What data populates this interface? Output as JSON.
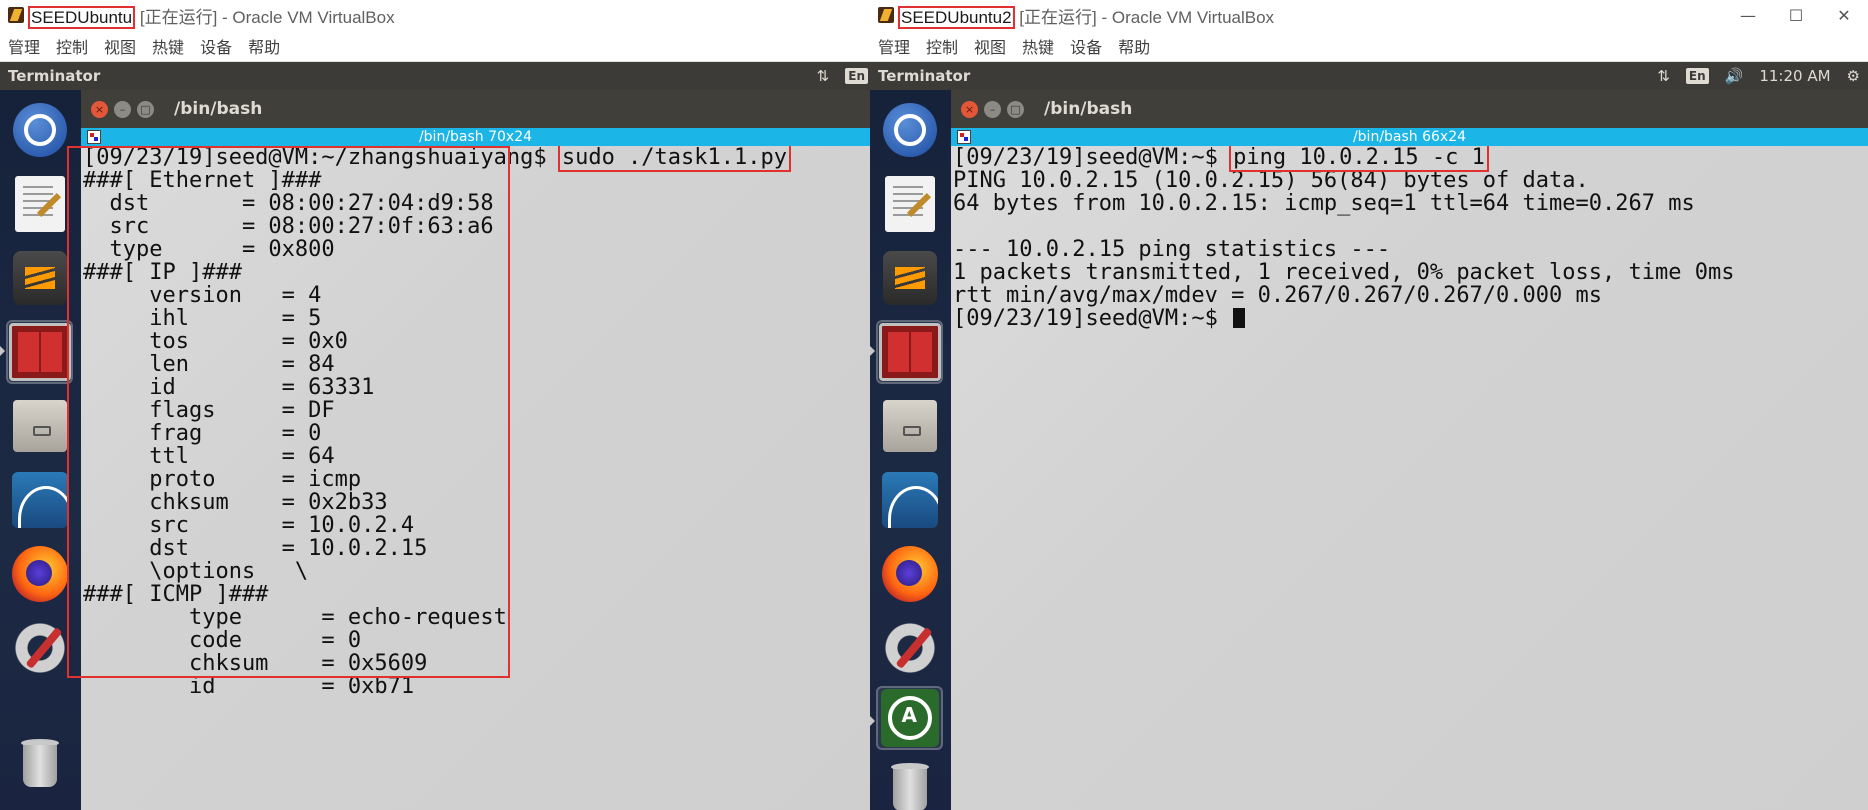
{
  "left_vm": {
    "title": {
      "vm_name": "SEEDUbuntu",
      "suffix": " [正在运行] - Oracle VM VirtualBox"
    },
    "menu": [
      "管理",
      "控制",
      "视图",
      "热键",
      "设备",
      "帮助"
    ],
    "topbar": {
      "app_name": "Terminator",
      "lang": "En"
    },
    "terminal": {
      "window_title": "/bin/bash",
      "tab_title": "/bin/bash 70x24",
      "prompt": "[09/23/19]seed@VM:~/zhangshuaiyang$ ",
      "command": "sudo ./task1.1.py",
      "output": [
        "###[ Ethernet ]###",
        "  dst       = 08:00:27:04:d9:58",
        "  src       = 08:00:27:0f:63:a6",
        "  type      = 0x800",
        "###[ IP ]###",
        "     version   = 4",
        "     ihl       = 5",
        "     tos       = 0x0",
        "     len       = 84",
        "     id        = 63331",
        "     flags     = DF",
        "     frag      = 0",
        "     ttl       = 64",
        "     proto     = icmp",
        "     chksum    = 0x2b33",
        "     src       = 10.0.2.4",
        "     dst       = 10.0.2.15",
        "     \\options   \\",
        "###[ ICMP ]###",
        "        type      = echo-request",
        "        code      = 0",
        "        chksum    = 0x5609",
        "        id        = 0xb71"
      ]
    }
  },
  "right_vm": {
    "title": {
      "vm_name": "SEEDUbuntu2",
      "suffix": " [正在运行] - Oracle VM VirtualBox"
    },
    "menu": [
      "管理",
      "控制",
      "视图",
      "热键",
      "设备",
      "帮助"
    ],
    "window_controls": {
      "minimize": "—",
      "maximize": "☐",
      "close": "✕"
    },
    "topbar": {
      "app_name": "Terminator",
      "lang": "En",
      "time": "11:20 AM",
      "network": "⇅",
      "volume": "🔊",
      "gear": "⚙"
    },
    "terminal": {
      "window_title": "/bin/bash",
      "tab_title": "/bin/bash 66x24",
      "prompt": "[09/23/19]seed@VM:~$ ",
      "command": "ping 10.0.2.15 -c 1",
      "output": [
        "PING 10.0.2.15 (10.0.2.15) 56(84) bytes of data.",
        "64 bytes from 10.0.2.15: icmp_seq=1 ttl=64 time=0.267 ms",
        "",
        "--- 10.0.2.15 ping statistics ---",
        "1 packets transmitted, 1 received, 0% packet loss, time 0ms",
        "rtt min/avg/max/mdev = 0.267/0.267/0.267/0.000 ms"
      ],
      "final_prompt": "[09/23/19]seed@VM:~$ "
    }
  },
  "launcher_icons": [
    "ubuntu-dash-icon",
    "text-editor-icon",
    "sublime-text-icon",
    "terminator-icon",
    "files-icon",
    "wireshark-icon",
    "firefox-icon",
    "system-settings-icon",
    "software-updater-icon",
    "trash-icon"
  ],
  "colors": {
    "highlight_red": "#e03030",
    "tab_bar_blue": "#1cb5e8",
    "unity_panel": "#3c3b37",
    "launcher_bg": "#16223a"
  }
}
